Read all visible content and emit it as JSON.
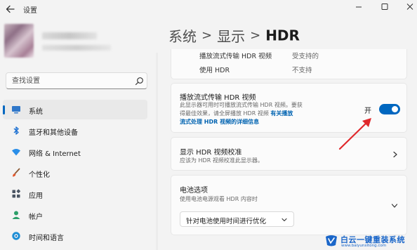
{
  "window": {
    "title": "设置",
    "controls": {
      "minimize_icon": "minimize-icon",
      "maximize_icon": "maximize-icon",
      "close_icon": "close-icon"
    }
  },
  "search": {
    "placeholder": "查找设置",
    "icon": "search-icon"
  },
  "sidebar": {
    "items": [
      {
        "label": "系统",
        "icon": "system-icon",
        "active": true
      },
      {
        "label": "蓝牙和其他设备",
        "icon": "bluetooth-icon",
        "active": false
      },
      {
        "label": "网络 & Internet",
        "icon": "wifi-icon",
        "active": false
      },
      {
        "label": "个性化",
        "icon": "brush-icon",
        "active": false
      },
      {
        "label": "应用",
        "icon": "apps-icon",
        "active": false
      },
      {
        "label": "帐户",
        "icon": "account-icon",
        "active": false
      },
      {
        "label": "时间和语言",
        "icon": "globe-icon",
        "active": false
      }
    ]
  },
  "breadcrumb": {
    "part1": "系统",
    "part2": "显示",
    "current": "HDR",
    "separator": ">"
  },
  "capabilities": [
    {
      "label": "播放流式传输 HDR 视频",
      "value": "受支持的"
    },
    {
      "label": "使用 HDR",
      "value": "不支持"
    }
  ],
  "streaming": {
    "title": "播放流式传输 HDR 视频",
    "description_line1": "此显示器可用时可播放流式传输 HDR 视频。要获",
    "description_line2": "得最佳效果，请全屏播放 HDR 视频",
    "link_part1": "有关播放",
    "link_part2": "流式处理 HDR 视频的详细信息",
    "toggle_label": "开",
    "toggle_on": true
  },
  "calibration": {
    "title": "显示 HDR 视频校准",
    "description": "应该为 HDR 视频校准此显示器。"
  },
  "battery": {
    "title": "电池选项",
    "description": "使用电池电源观看 HDR 内容时",
    "dropdown_value": "针对电池使用时间进行优化"
  },
  "watermark": {
    "brand": "白云一键重装系统",
    "url": "www.baiyunxitong.com"
  },
  "colors": {
    "accent": "#0067c0",
    "annotation": "#e0282c",
    "link": "#0063b1",
    "watermark": "#1a66c9"
  }
}
